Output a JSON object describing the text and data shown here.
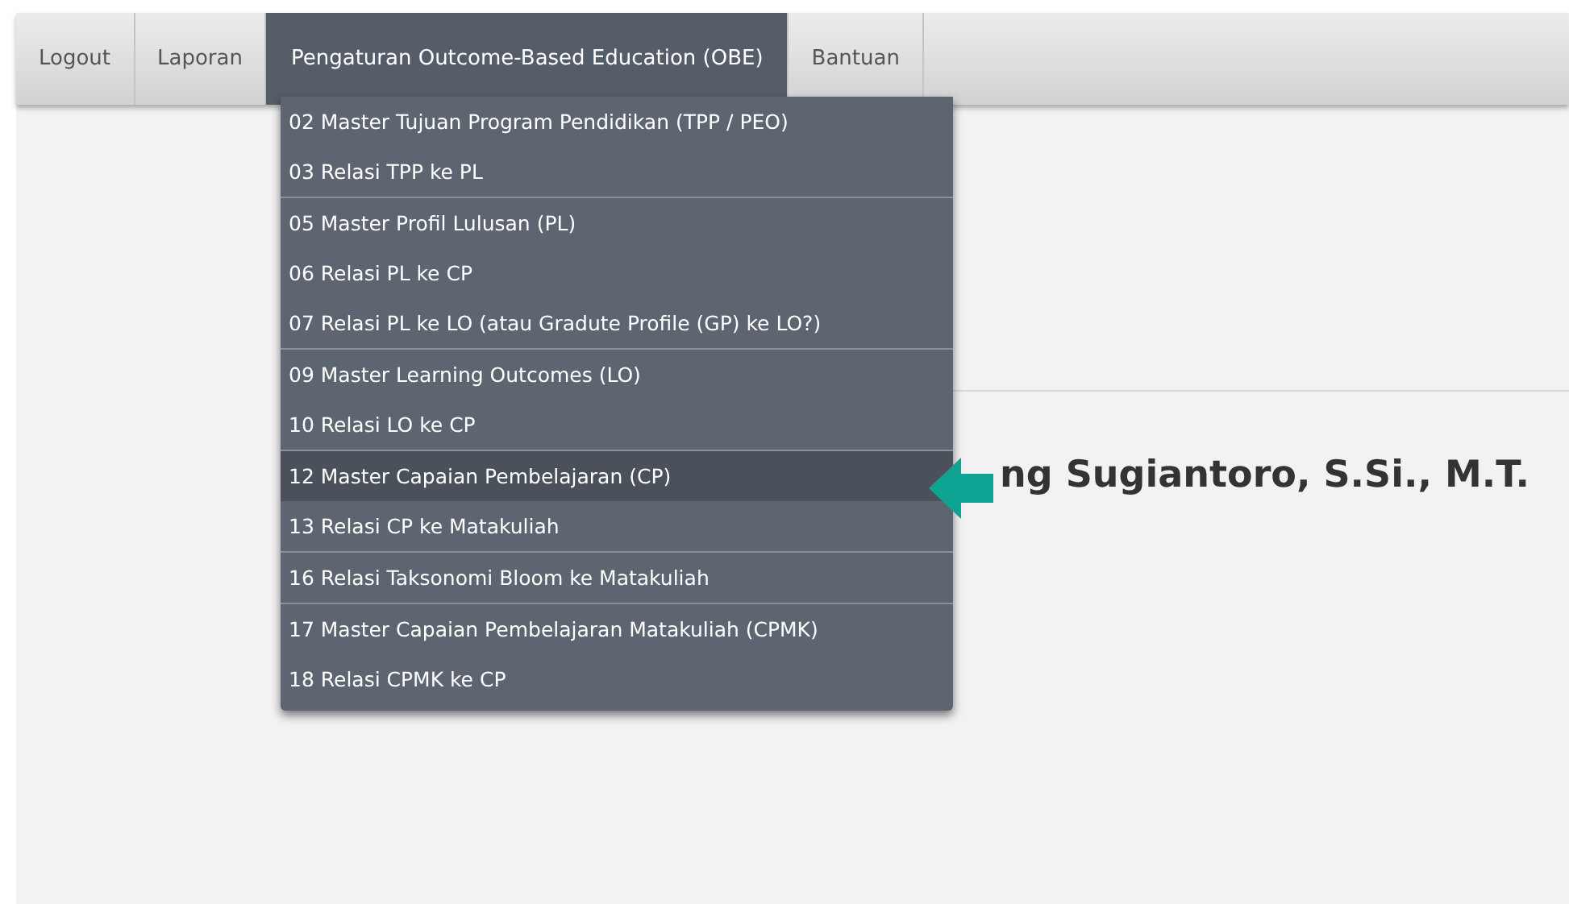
{
  "nav_tabs": [
    {
      "label": "Logout",
      "selected": false
    },
    {
      "label": "Laporan",
      "selected": false
    },
    {
      "label": "Pengaturan Outcome-Based Education (OBE)",
      "selected": true
    },
    {
      "label": "Bantuan",
      "selected": false
    }
  ],
  "dropdown_menu": {
    "groups": [
      {
        "items": [
          {
            "label": "02 Master Tujuan Program Pendidikan (TPP / PEO)",
            "selected": false
          },
          {
            "label": "03 Relasi TPP ke PL",
            "selected": false
          }
        ]
      },
      {
        "items": [
          {
            "label": "05 Master Profil Lulusan (PL)",
            "selected": false
          },
          {
            "label": "06 Relasi PL ke CP",
            "selected": false
          },
          {
            "label": "07 Relasi PL ke LO (atau Gradute Profile (GP) ke LO?)",
            "selected": false
          }
        ]
      },
      {
        "items": [
          {
            "label": "09 Master Learning Outcomes (LO)",
            "selected": false
          },
          {
            "label": "10 Relasi LO ke CP",
            "selected": false
          }
        ]
      },
      {
        "items": [
          {
            "label": "12 Master Capaian Pembelajaran (CP)",
            "selected": true
          },
          {
            "label": "13 Relasi CP ke Matakuliah",
            "selected": false
          }
        ]
      },
      {
        "items": [
          {
            "label": "16 Relasi Taksonomi Bloom ke Matakuliah",
            "selected": false
          }
        ]
      },
      {
        "items": [
          {
            "label": "17 Master Capaian Pembelajaran Matakuliah (CPMK)",
            "selected": false
          },
          {
            "label": "18 Relasi CPMK ke CP",
            "selected": false
          }
        ]
      }
    ]
  },
  "heading": "ng Sugiantoro, S.Si., M.T."
}
